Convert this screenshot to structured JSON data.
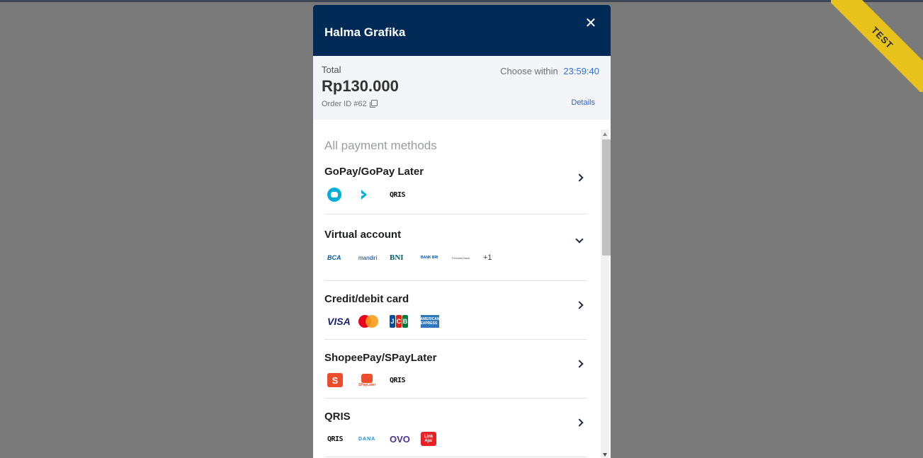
{
  "ribbon": {
    "label": "TEST"
  },
  "header": {
    "merchant": "Halma Grafika",
    "close_glyph": "✕"
  },
  "summary": {
    "total_label": "Total",
    "amount": "Rp130.000",
    "order_id": "Order ID #62",
    "timer_label": "Choose within",
    "timer_value": "23:59:40",
    "details_label": "Details"
  },
  "payments": {
    "section_title": "All payment methods",
    "methods": [
      {
        "name": "GoPay/GoPay Later",
        "indicator": "chevron-right",
        "logos": [
          "gopay-icon",
          "gopay-later-icon",
          "QRIS"
        ]
      },
      {
        "name": "Virtual account",
        "indicator": "chevron-down",
        "logos": [
          "BCA",
          "mandiri",
          "BNI",
          "BANK BRI",
          "Permata Bank"
        ],
        "more": "+1"
      },
      {
        "name": "Credit/debit card",
        "indicator": "chevron-right",
        "logos": [
          "VISA",
          "mastercard-icon",
          "JCB",
          "AMERICAN EXPRESS"
        ]
      },
      {
        "name": "ShopeePay/SPayLater",
        "indicator": "chevron-right",
        "logos": [
          "S",
          "SPayLater",
          "QRIS"
        ]
      },
      {
        "name": "QRIS",
        "indicator": "chevron-right",
        "logos": [
          "QRIS",
          "DANA",
          "OVO",
          "Link Aja!"
        ]
      }
    ]
  },
  "colors": {
    "header_bg": "#012a57",
    "accent_blue": "#2f6fd6",
    "ribbon": "#e6c21a"
  }
}
